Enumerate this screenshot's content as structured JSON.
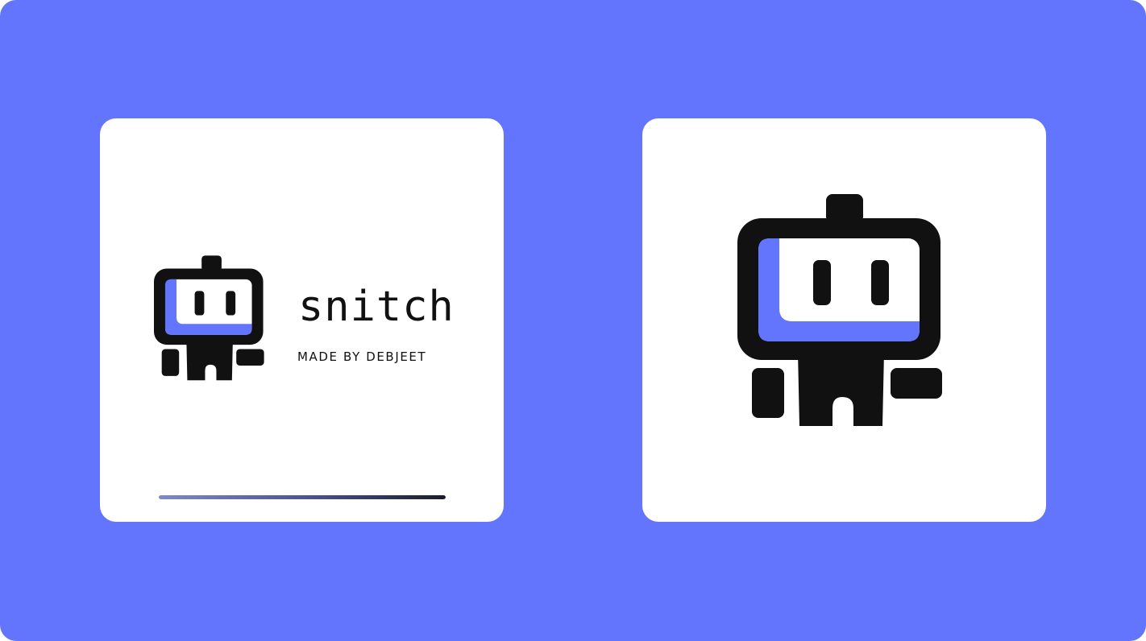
{
  "brand": {
    "name": "snitch",
    "tagline": "MADE BY DEBJEET",
    "icon": "robot-mascot-icon"
  },
  "splash": {
    "progress": 1.0
  },
  "colors": {
    "background": "#6374fd",
    "card": "#ffffff",
    "ink": "#111111",
    "accent": "#6374fd"
  }
}
